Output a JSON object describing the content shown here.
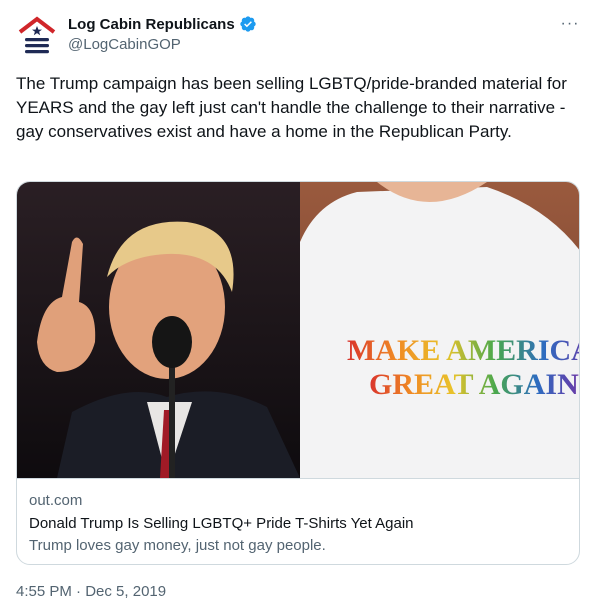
{
  "author": {
    "display_name": "Log Cabin Republicans",
    "handle": "@LogCabinGOP",
    "verified": true,
    "avatar_icon": "log-cabin-logo-icon",
    "verified_icon": "verified-badge-icon",
    "verified_color": "#1d9bf0"
  },
  "menu": {
    "more_icon": "more-horizontal-icon",
    "more_label": "···"
  },
  "tweet": {
    "text": "The Trump campaign has been selling LGBTQ/pride-branded material for YEARS and the gay left just can't handle the challenge to their narrative - gay conservatives exist and have a home in the Republican Party."
  },
  "card": {
    "domain": "out.com",
    "title": "Donald Trump Is Selling LGBTQ+ Pride T-Shirts Yet Again",
    "description": "Trump loves gay money, just not gay people.",
    "shirt_text_line1": "MAKE AMERICA",
    "shirt_text_line2": "GREAT AGAIN"
  },
  "footer": {
    "time": "4:55 PM",
    "separator": "·",
    "date": "Dec 5, 2019"
  },
  "colors": {
    "text_primary": "#0f1419",
    "text_secondary": "#536471",
    "border": "#cfd9de",
    "logo_red": "#d0262a",
    "logo_navy": "#1f2a55"
  }
}
